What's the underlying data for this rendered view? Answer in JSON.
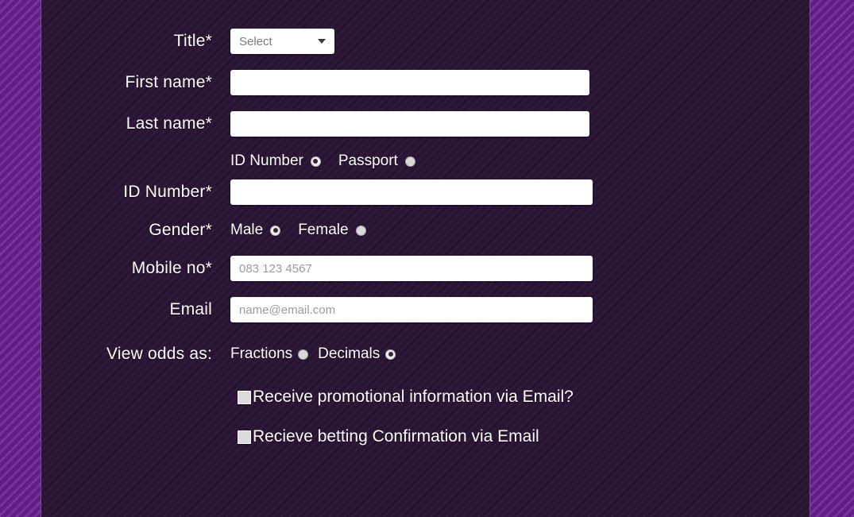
{
  "colors": {
    "frame_purple": "#6b2091",
    "panel_dark": "#2a1434",
    "panel_border": "#7b4d94",
    "label_text": "#ffffff",
    "input_bg": "#ffffff",
    "placeholder_text": "#9b9b9b",
    "radio_fill": "#d8d8d8",
    "checkbox_fill": "#dcdcdc"
  },
  "form": {
    "title": {
      "label": "Title*",
      "select_value": "Select",
      "caret_icon": "chevron-down-icon"
    },
    "first_name": {
      "label": "First name*",
      "value": "",
      "placeholder": ""
    },
    "last_name": {
      "label": "Last name*",
      "value": "",
      "placeholder": ""
    },
    "id_type": {
      "label": "",
      "options": [
        {
          "label": "ID Number",
          "selected": true
        },
        {
          "label": "Passport",
          "selected": false
        }
      ]
    },
    "id_number": {
      "label": "ID Number*",
      "value": "",
      "placeholder": ""
    },
    "gender": {
      "label": "Gender*",
      "options": [
        {
          "label": "Male",
          "selected": true
        },
        {
          "label": "Female",
          "selected": false
        }
      ]
    },
    "mobile": {
      "label": "Mobile no*",
      "value": "",
      "placeholder": "083 123 4567"
    },
    "email": {
      "label": "Email",
      "value": "",
      "placeholder": "name@email.com"
    },
    "odds_view": {
      "label": "View odds as:",
      "options": [
        {
          "label": "Fractions",
          "selected": false
        },
        {
          "label": "Decimals",
          "selected": true
        }
      ]
    },
    "checkboxes": [
      {
        "label": "Receive promotional information via Email?",
        "checked": false
      },
      {
        "label": "Recieve betting Confirmation via Email",
        "checked": false
      }
    ]
  }
}
